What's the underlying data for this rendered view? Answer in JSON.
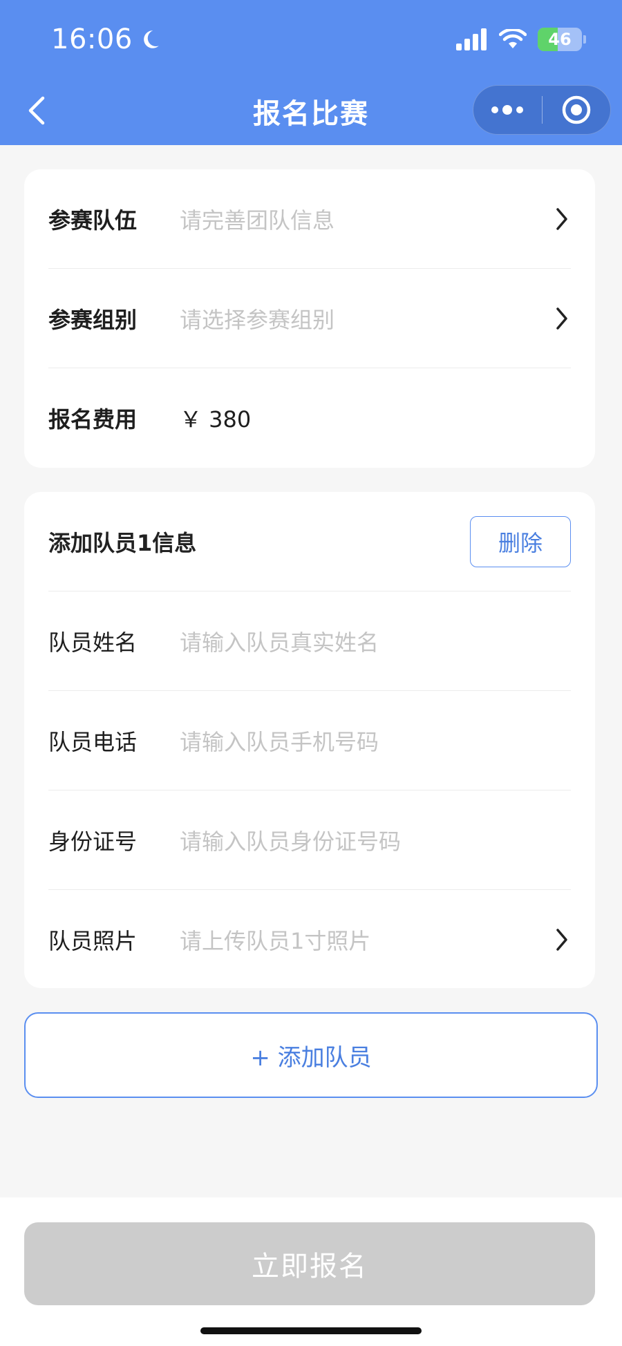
{
  "status_bar": {
    "time": "16:06",
    "battery": {
      "text": "46",
      "level": 0.46
    }
  },
  "nav": {
    "title": "报名比赛"
  },
  "team_card": {
    "rows": [
      {
        "label": "参赛队伍",
        "placeholder": "请完善团队信息"
      },
      {
        "label": "参赛组别",
        "placeholder": "请选择参赛组别"
      },
      {
        "label": "报名费用",
        "value": "￥ 380"
      }
    ]
  },
  "member_card": {
    "title": "添加队员1信息",
    "delete_label": "删除",
    "rows": [
      {
        "label": "队员姓名",
        "placeholder": "请输入队员真实姓名"
      },
      {
        "label": "队员电话",
        "placeholder": "请输入队员手机号码"
      },
      {
        "label": "身份证号",
        "placeholder": "请输入队员身份证号码"
      },
      {
        "label": "队员照片",
        "placeholder": "请上传队员1寸照片"
      }
    ]
  },
  "add_member_label": "+ 添加队员",
  "submit_label": "立即报名",
  "colors": {
    "header": "#5a8ef0",
    "accent": "#4a7fe0",
    "disabled_button": "#cccccc"
  }
}
